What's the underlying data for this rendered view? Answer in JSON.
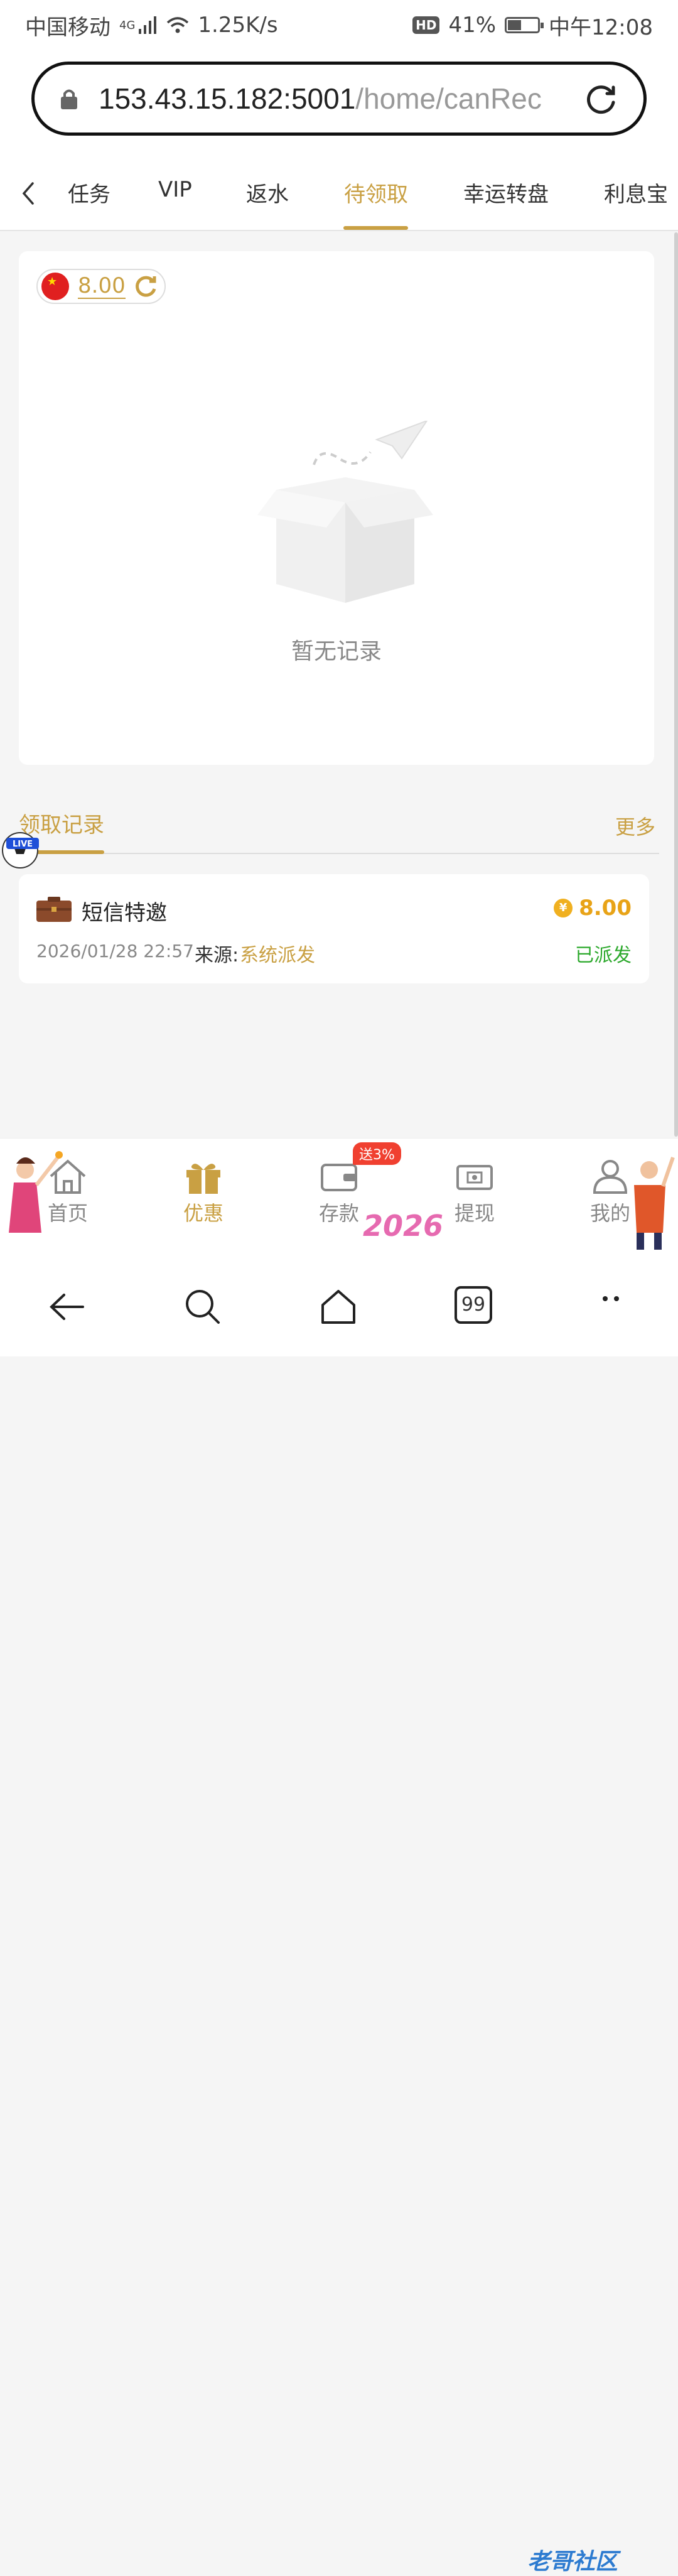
{
  "status_bar": {
    "carrier": "中国移动",
    "network": "4G",
    "speed": "1.25K/s",
    "hd": "HD",
    "battery": "41%",
    "battery_level": 0.41,
    "time": "中午12:08"
  },
  "browser": {
    "url_host": "153.43.15.182:5001",
    "url_path": "/home/canRec"
  },
  "tabs": {
    "items": [
      "任务",
      "VIP",
      "返水",
      "待领取",
      "幸运转盘",
      "利息宝"
    ],
    "active_index": 3
  },
  "wallet": {
    "balance": "8.00"
  },
  "empty": {
    "text": "暂无记录"
  },
  "records": {
    "title": "领取记录",
    "more": "更多",
    "live": "LIVE",
    "items": [
      {
        "name": "短信特邀",
        "amount": "8.00",
        "time": "2026/01/28 22:57",
        "source_label": "来源:",
        "source": "系统派发",
        "status": "已派发"
      }
    ]
  },
  "bottom_nav": {
    "items": [
      "首页",
      "优惠",
      "存款",
      "提现",
      "我的"
    ],
    "active_index": 1,
    "deposit_badge": "送3%",
    "deco_year": "2026"
  },
  "system_nav": {
    "tabs_count": "99"
  },
  "watermark": {
    "text": "老哥社区"
  },
  "colors": {
    "accent": "#c9a043",
    "success": "#2da92d",
    "amount": "#e8a317",
    "badge": "#f04030"
  }
}
